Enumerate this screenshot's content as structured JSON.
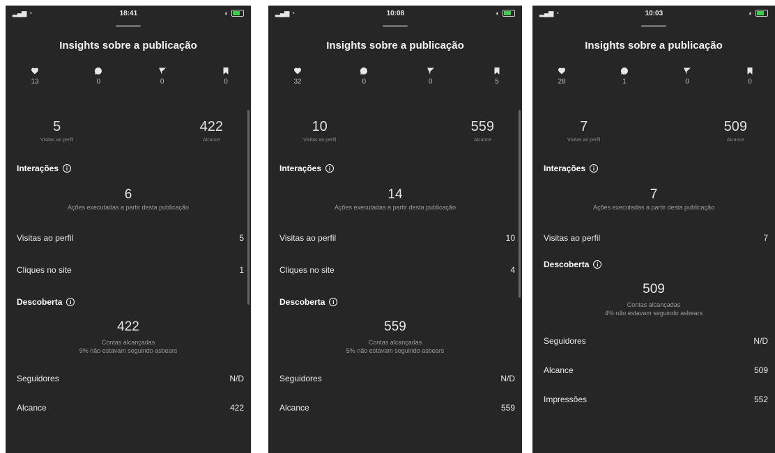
{
  "panels": [
    {
      "time": "18:41",
      "title": "Insights sobre a publicação",
      "icon_counts": [
        "13",
        "0",
        "0",
        "0"
      ],
      "profile_visits_value": "5",
      "profile_visits_label": "Visitas ao perfil",
      "reach_value": "422",
      "reach_label": "Alcance",
      "interactions_label": "Interações",
      "interactions_value": "6",
      "interactions_caption": "Ações executadas a partir desta publicação",
      "rows": [
        {
          "label": "Visitas ao perfil",
          "value": "5"
        },
        {
          "label": "Cliques no site",
          "value": "1"
        }
      ],
      "discovery_label": "Descoberta",
      "discovery_value": "422",
      "discovery_caption": "Contas alcançadas",
      "discovery_note": "9% não estavam seguindo asbears",
      "bottom_rows": [
        {
          "label": "Seguidores",
          "value": "N/D"
        },
        {
          "label": "Alcance",
          "value": "422"
        }
      ]
    },
    {
      "time": "10:08",
      "title": "Insights sobre a publicação",
      "icon_counts": [
        "32",
        "0",
        "0",
        "5"
      ],
      "profile_visits_value": "10",
      "profile_visits_label": "Visitas ao perfil",
      "reach_value": "559",
      "reach_label": "Alcance",
      "interactions_label": "Interações",
      "interactions_value": "14",
      "interactions_caption": "Ações executadas a partir desta publicação",
      "rows": [
        {
          "label": "Visitas ao perfil",
          "value": "10"
        },
        {
          "label": "Cliques no site",
          "value": "4"
        }
      ],
      "discovery_label": "Descoberta",
      "discovery_value": "559",
      "discovery_caption": "Contas alcançadas",
      "discovery_note": "5% não estavam seguindo asbears",
      "bottom_rows": [
        {
          "label": "Seguidores",
          "value": "N/D"
        },
        {
          "label": "Alcance",
          "value": "559"
        }
      ]
    },
    {
      "time": "10:03",
      "title": "Insights sobre a publicação",
      "icon_counts": [
        "28",
        "1",
        "0",
        "0"
      ],
      "profile_visits_value": "7",
      "profile_visits_label": "Visitas ao perfil",
      "reach_value": "509",
      "reach_label": "Alcance",
      "interactions_label": "Interações",
      "interactions_value": "7",
      "interactions_caption": "Ações executadas a partir desta publicação",
      "rows": [
        {
          "label": "Visitas ao perfil",
          "value": "7"
        }
      ],
      "discovery_label": "Descoberta",
      "discovery_value": "509",
      "discovery_caption": "Contas alcançadas",
      "discovery_note": "4% não estavam seguindo asbears",
      "bottom_rows": [
        {
          "label": "Seguidores",
          "value": "N/D"
        },
        {
          "label": "Alcance",
          "value": "509"
        },
        {
          "label": "Impressões",
          "value": "552"
        }
      ]
    }
  ],
  "icons": [
    "heart-icon",
    "comment-icon",
    "share-icon",
    "bookmark-icon"
  ],
  "colors": {
    "background": "#262626",
    "battery": "#3ccf4e",
    "text": "#ffffff"
  }
}
